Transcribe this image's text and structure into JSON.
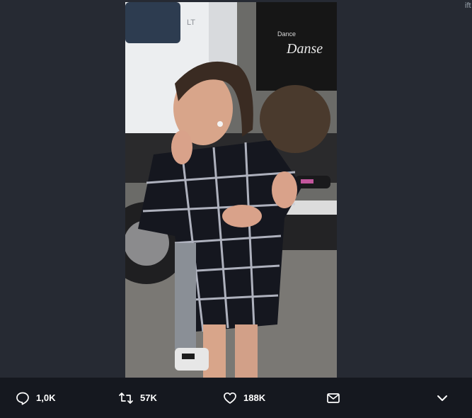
{
  "viewer": {
    "edge_text": "ift",
    "photo": {
      "vehicle_badge": "LT",
      "shirt_text_small": "Dance",
      "shirt_text_large": "Danse"
    }
  },
  "actions": {
    "reply": {
      "icon": "reply-icon",
      "count": "1,0K"
    },
    "retweet": {
      "icon": "retweet-icon",
      "count": "57K"
    },
    "like": {
      "icon": "heart-icon",
      "count": "188K"
    },
    "direct_message": {
      "icon": "envelope-icon"
    },
    "more": {
      "icon": "chevron-down-icon"
    }
  },
  "colors": {
    "background": "#262a33",
    "action_bar": "#15181f",
    "text": "#ffffff"
  }
}
